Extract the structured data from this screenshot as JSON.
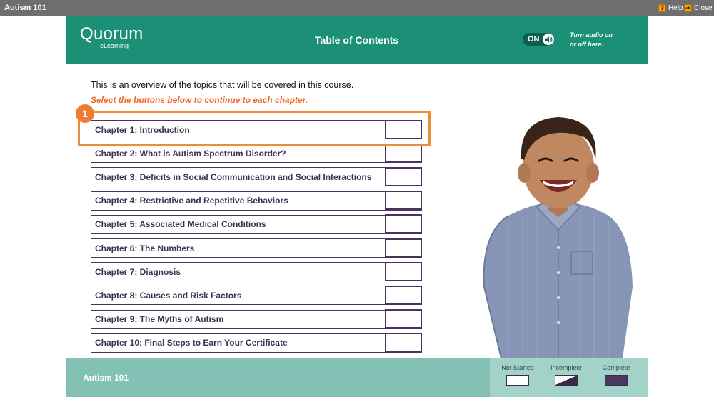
{
  "window": {
    "title": "Autism 101",
    "help_label": "Help",
    "close_label": "Close"
  },
  "header": {
    "logo_main": "Quorum",
    "logo_sub": "eLearning",
    "page_title": "Table of Contents",
    "audio_state": "ON",
    "audio_hint_line1": "Turn audio on",
    "audio_hint_line2": "or off here."
  },
  "intro_text": "This is an overview of the topics that will be covered in this course.",
  "instruction_text": "Select the buttons below to continue to each chapter.",
  "step_badge": "1",
  "chapters": [
    {
      "label": "Chapter 1: Introduction",
      "status": "not-started"
    },
    {
      "label": "Chapter 2: What is Autism Spectrum Disorder?",
      "status": "not-started"
    },
    {
      "label": "Chapter 3: Deficits in Social Communication and Social Interactions",
      "status": "not-started"
    },
    {
      "label": "Chapter 4: Restrictive and Repetitive Behaviors",
      "status": "not-started"
    },
    {
      "label": "Chapter 5: Associated Medical Conditions",
      "status": "not-started"
    },
    {
      "label": "Chapter 6: The Numbers",
      "status": "not-started"
    },
    {
      "label": "Chapter 7: Diagnosis",
      "status": "not-started"
    },
    {
      "label": "Chapter 8: Causes and Risk Factors",
      "status": "not-started"
    },
    {
      "label": "Chapter 9: The Myths of Autism",
      "status": "not-started"
    },
    {
      "label": "Chapter 10: Final Steps to Earn Your Certificate",
      "status": "not-started"
    }
  ],
  "footer": {
    "title": "Autism 101",
    "legend": {
      "not_started": "Not Started",
      "incomplete": "Incomplete",
      "complete": "Complete"
    }
  },
  "colors": {
    "header_bg": "#1b9077",
    "footer_bg": "#82c1b3",
    "accent_orange": "#ef7d31",
    "chapter_border": "#48325e"
  }
}
